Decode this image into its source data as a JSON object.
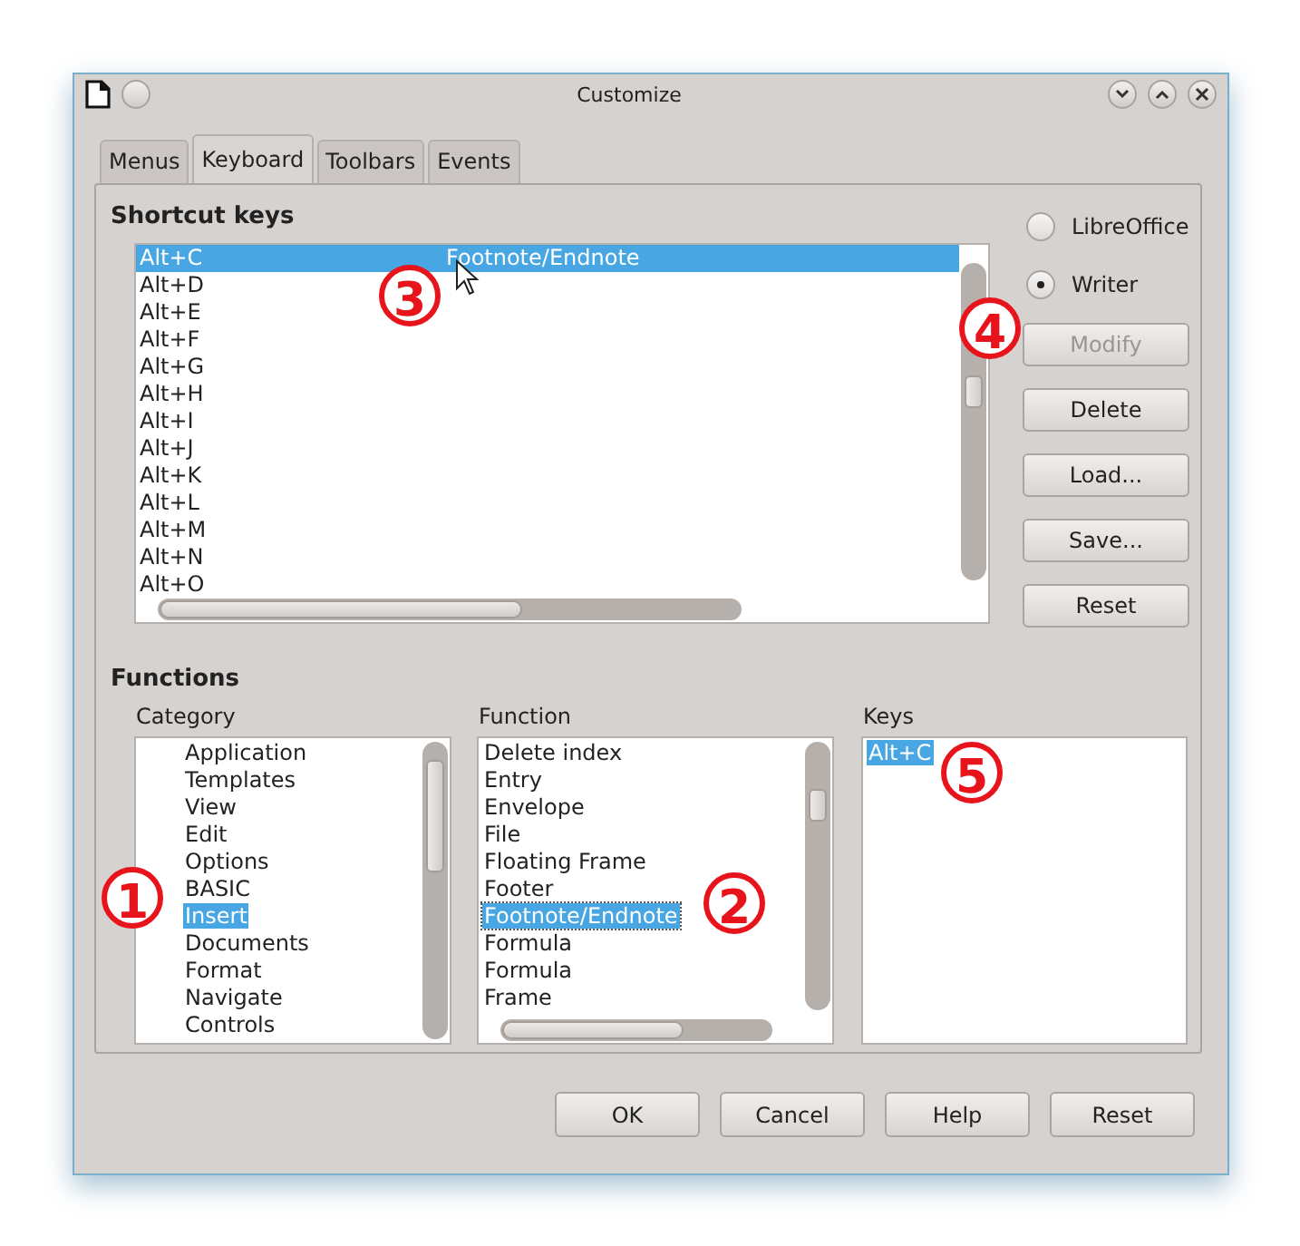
{
  "window": {
    "title": "Customize"
  },
  "tabs": [
    {
      "label": "Menus",
      "selected": false
    },
    {
      "label": "Keyboard",
      "selected": true
    },
    {
      "label": "Toolbars",
      "selected": false
    },
    {
      "label": "Events",
      "selected": false
    }
  ],
  "shortcut_keys": {
    "title": "Shortcut keys",
    "rows": [
      {
        "key": "Alt+C",
        "function": "Footnote/Endnote",
        "selected": true
      },
      {
        "key": "Alt+D",
        "selected": false
      },
      {
        "key": "Alt+E",
        "selected": false
      },
      {
        "key": "Alt+F",
        "selected": false
      },
      {
        "key": "Alt+G",
        "selected": false
      },
      {
        "key": "Alt+H",
        "selected": false
      },
      {
        "key": "Alt+I",
        "selected": false
      },
      {
        "key": "Alt+J",
        "selected": false
      },
      {
        "key": "Alt+K",
        "selected": false
      },
      {
        "key": "Alt+L",
        "selected": false
      },
      {
        "key": "Alt+M",
        "selected": false
      },
      {
        "key": "Alt+N",
        "selected": false
      },
      {
        "key": "Alt+O",
        "selected": false
      }
    ]
  },
  "scope": [
    {
      "label": "LibreOffice",
      "selected": false
    },
    {
      "label": "Writer",
      "selected": true
    }
  ],
  "side_buttons": [
    {
      "label": "Modify",
      "disabled": true
    },
    {
      "label": "Delete",
      "disabled": false
    },
    {
      "label": "Load...",
      "disabled": false
    },
    {
      "label": "Save...",
      "disabled": false
    },
    {
      "label": "Reset",
      "disabled": false
    }
  ],
  "functions": {
    "title": "Functions",
    "lists": [
      {
        "label": "Category",
        "kind": "indented",
        "items": [
          {
            "label": "Application",
            "selected": false
          },
          {
            "label": "Templates",
            "selected": false
          },
          {
            "label": "View",
            "selected": false
          },
          {
            "label": "Edit",
            "selected": false
          },
          {
            "label": "Options",
            "selected": false
          },
          {
            "label": "BASIC",
            "selected": false
          },
          {
            "label": "Insert",
            "selected": true
          },
          {
            "label": "Documents",
            "selected": false
          },
          {
            "label": "Format",
            "selected": false
          },
          {
            "label": "Navigate",
            "selected": false
          },
          {
            "label": "Controls",
            "selected": false
          }
        ]
      },
      {
        "label": "Function",
        "kind": "scrolling",
        "items": [
          {
            "label": "Delete index",
            "selected": false
          },
          {
            "label": "Entry",
            "selected": false
          },
          {
            "label": "Envelope",
            "selected": false
          },
          {
            "label": "File",
            "selected": false
          },
          {
            "label": "Floating Frame",
            "selected": false
          },
          {
            "label": "Footer",
            "selected": false
          },
          {
            "label": "Footnote/Endnote",
            "selected": true
          },
          {
            "label": "Formula",
            "selected": false
          },
          {
            "label": "Formula",
            "selected": false
          },
          {
            "label": "Frame",
            "selected": false
          }
        ]
      },
      {
        "label": "Keys",
        "kind": "plain",
        "items": [
          {
            "label": "Alt+C",
            "selected": true
          }
        ]
      }
    ]
  },
  "buttons": [
    {
      "label": "OK"
    },
    {
      "label": "Cancel"
    },
    {
      "label": "Help"
    },
    {
      "label": "Reset"
    }
  ],
  "callouts": [
    {
      "label": "1"
    },
    {
      "label": "2"
    },
    {
      "label": "3"
    },
    {
      "label": "4"
    },
    {
      "label": "5"
    }
  ]
}
